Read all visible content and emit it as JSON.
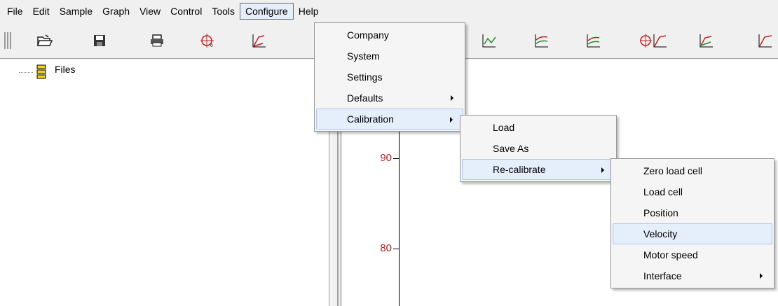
{
  "menubar": {
    "items": [
      "File",
      "Edit",
      "Sample",
      "Graph",
      "View",
      "Control",
      "Tools",
      "Configure",
      "Help"
    ],
    "active": "Configure"
  },
  "toolbar": {
    "buttons": [
      "open-folder-icon",
      "save-disk-icon",
      "print-icon",
      "crosshair-tool-icon",
      "curve-tool-icon",
      "graph-tool-icon",
      "fpv-graph-icon",
      "spv-graph-icon",
      "crosshair-curve-icon",
      "scale-graph-icon",
      "curve-graph-icon"
    ]
  },
  "tree": {
    "root_label": "Files"
  },
  "graph": {
    "tick_labels": [
      "90",
      "80"
    ],
    "label_color": "#b01e1e"
  },
  "configure_menu": {
    "items": [
      {
        "label": "Company",
        "submenu": false
      },
      {
        "label": "System",
        "submenu": false
      },
      {
        "label": "Settings",
        "submenu": false
      },
      {
        "label": "Defaults",
        "submenu": true
      },
      {
        "label": "Calibration",
        "submenu": true,
        "highlighted": true
      }
    ]
  },
  "calibration_menu": {
    "items": [
      {
        "label": "Load",
        "submenu": false
      },
      {
        "label": "Save As",
        "submenu": false
      },
      {
        "label": "Re-calibrate",
        "submenu": true,
        "highlighted": true
      }
    ]
  },
  "recalibrate_menu": {
    "items": [
      {
        "label": "Zero load cell",
        "submenu": false
      },
      {
        "label": "Load cell",
        "submenu": false
      },
      {
        "label": "Position",
        "submenu": false
      },
      {
        "label": "Velocity",
        "submenu": false,
        "highlighted": true
      },
      {
        "label": "Motor speed",
        "submenu": false
      },
      {
        "label": "Interface",
        "submenu": true
      }
    ]
  },
  "colors": {
    "menu_highlight": "#e5eefb",
    "menu_highlight_border": "#aec6ec"
  }
}
